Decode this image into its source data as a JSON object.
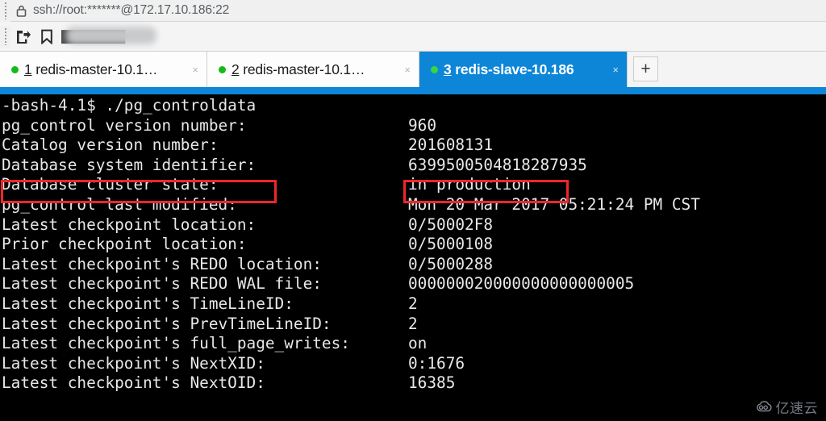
{
  "window": {
    "title": "ssh://root:*******@172.17.10.186:22",
    "lock_icon": "lock-icon",
    "grip_icon": "drag-grip-icon"
  },
  "toolbar": {
    "buttons": [
      {
        "name": "send-to-icon",
        "glyph": "send-to"
      },
      {
        "name": "bookmark-icon",
        "glyph": "bookmark"
      }
    ],
    "redacted_label": "████████"
  },
  "tabs": {
    "items": [
      {
        "index": "1",
        "title": " redis-master-10.1…",
        "active": false,
        "status": "connected",
        "close_label": "×"
      },
      {
        "index": "2",
        "title": " redis-master-10.1…",
        "active": false,
        "status": "connected",
        "close_label": "×"
      },
      {
        "index": "3",
        "title": " redis-slave-10.186",
        "active": true,
        "status": "connected",
        "close_label": "×"
      }
    ],
    "new_tab_label": "+",
    "active_color": "#0d86d8",
    "status_dot_color": "#16b91a"
  },
  "terminal": {
    "prompt": "-bash-4.1$ ./pg_controldata",
    "highlight_color": "#f0262a",
    "rows": [
      {
        "key": "pg_control version number:",
        "value": "960"
      },
      {
        "key": "Catalog version number:",
        "value": "201608131"
      },
      {
        "key": "Database system identifier:",
        "value": "6399500504818287935"
      },
      {
        "key": "Database cluster state:",
        "value": "in production",
        "highlighted": true
      },
      {
        "key": "pg_control last modified:",
        "value": "Mon 20 Mar 2017 05:21:24 PM CST"
      },
      {
        "key": "Latest checkpoint location:",
        "value": "0/50002F8"
      },
      {
        "key": "Prior checkpoint location:",
        "value": "0/5000108"
      },
      {
        "key": "Latest checkpoint's REDO location:",
        "value": "0/5000288"
      },
      {
        "key": "Latest checkpoint's REDO WAL file:",
        "value": "000000020000000000000005"
      },
      {
        "key": "Latest checkpoint's TimeLineID:",
        "value": "2"
      },
      {
        "key": "Latest checkpoint's PrevTimeLineID:",
        "value": "2"
      },
      {
        "key": "Latest checkpoint's full_page_writes:",
        "value": "on"
      },
      {
        "key": "Latest checkpoint's NextXID:",
        "value": "0:1676"
      },
      {
        "key": "Latest checkpoint's NextOID:",
        "value": "16385"
      }
    ]
  },
  "watermark": {
    "text": "亿速云",
    "icon": "cloud-icon"
  }
}
